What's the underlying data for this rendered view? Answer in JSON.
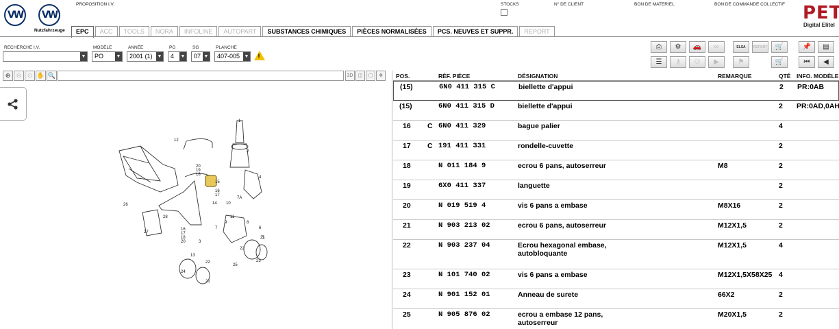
{
  "header": {
    "brand_sub": "Nutzfahrzeuge",
    "proposition_label": "PROPOSITION I.V.",
    "stocks_label": "STOCKS",
    "client_label": "N° DE CLIENT",
    "material_label": "BON DE MATERIEL",
    "order_label": "BON DE COMMANDE COLLECTIF",
    "logo_text": "PETK",
    "logo_sub": "Digital Elitel"
  },
  "tabs": [
    {
      "label": "EPC",
      "state": "active"
    },
    {
      "label": "ACC",
      "state": "disabled"
    },
    {
      "label": "TOOLS",
      "state": "disabled"
    },
    {
      "label": "NORA",
      "state": "disabled"
    },
    {
      "label": "INFOLINE",
      "state": "disabled"
    },
    {
      "label": "AUTOPART",
      "state": "disabled"
    },
    {
      "label": "SUBSTANCES CHIMIQUES",
      "state": "enabled"
    },
    {
      "label": "PIÈCES NORMALISÉES",
      "state": "enabled"
    },
    {
      "label": "PCS. NEUVES ET SUPPR.",
      "state": "enabled"
    },
    {
      "label": "REPORT",
      "state": "disabled"
    }
  ],
  "filters": {
    "recherche_label": "RECHERCHE I.V.",
    "recherche_value": "",
    "modele_label": "MODÈLE",
    "modele_value": "PO",
    "annee_label": "ANNÉE",
    "annee_value": "2001 (1)",
    "pg_label": "PG",
    "pg_value": "4",
    "sg_label": "SG",
    "sg_value": "07",
    "planche_label": "PLANCHE",
    "planche_value": "407-005"
  },
  "toolbar": {
    "elsa_label": "ELSA",
    "report_label": "REPORT"
  },
  "illustration": {
    "view3d_label": "3D",
    "callouts": [
      "12",
      "20",
      "19",
      "18",
      "15",
      "16",
      "17",
      "14",
      "26",
      "28",
      "27",
      "16",
      "17",
      "18",
      "20",
      "3",
      "10",
      "11",
      "9",
      "7",
      "8",
      "6",
      "5",
      "7A",
      "1",
      "2",
      "4",
      "13",
      "22",
      "24",
      "21",
      "25",
      "23",
      "21",
      "22"
    ]
  },
  "table": {
    "headers": {
      "pos": "POS.",
      "ref": "RÉF. PIÈCE",
      "desig": "DÉSIGNATION",
      "remarque": "REMARQUE",
      "qte": "QTÉ",
      "info": "INFO. MODÈLE"
    },
    "rows": [
      {
        "pos": "(15)",
        "flag": "",
        "ref": "6N0  411  315  C",
        "desig": "biellette d'appui",
        "desig2": "",
        "remarque": "",
        "qte": "2",
        "info": "PR:0AB"
      },
      {
        "pos": "(15)",
        "flag": "",
        "ref": "6N0  411  315  D",
        "desig": "biellette d'appui",
        "desig2": "",
        "remarque": "",
        "qte": "2",
        "info": "PR:0AD,0AH"
      },
      {
        "pos": "16",
        "flag": "C",
        "ref": "6N0  411  329",
        "desig": "bague palier",
        "desig2": "",
        "remarque": "",
        "qte": "4",
        "info": ""
      },
      {
        "pos": "17",
        "flag": "C",
        "ref": "191  411  331",
        "desig": "rondelle-cuvette",
        "desig2": "",
        "remarque": "",
        "qte": "2",
        "info": ""
      },
      {
        "pos": "18",
        "flag": "",
        "ref": "N    011  184  9",
        "desig": "ecrou 6 pans, autoserreur",
        "desig2": "",
        "remarque": "M8",
        "qte": "2",
        "info": ""
      },
      {
        "pos": "19",
        "flag": "",
        "ref": "6X0  411  337",
        "desig": "languette",
        "desig2": "",
        "remarque": "",
        "qte": "2",
        "info": ""
      },
      {
        "pos": "20",
        "flag": "",
        "ref": "N    019  519  4",
        "desig": "vis 6 pans a embase",
        "desig2": "",
        "remarque": "M8X16",
        "qte": "2",
        "info": ""
      },
      {
        "pos": "21",
        "flag": "",
        "ref": "N    903  213  02",
        "desig": "ecrou 6 pans, autoserreur",
        "desig2": "",
        "remarque": "M12X1,5",
        "qte": "2",
        "info": ""
      },
      {
        "pos": "22",
        "flag": "",
        "ref": "N    903  237  04",
        "desig": "Ecrou hexagonal embase,",
        "desig2": "autobloquante",
        "remarque": "M12X1,5",
        "qte": "4",
        "info": ""
      },
      {
        "pos": "23",
        "flag": "",
        "ref": "N    101  740  02",
        "desig": "vis 6 pans a embase",
        "desig2": "",
        "remarque": "M12X1,5X58X25",
        "qte": "4",
        "info": ""
      },
      {
        "pos": "24",
        "flag": "",
        "ref": "N    901  152  01",
        "desig": "Anneau de surete",
        "desig2": "",
        "remarque": "66X2",
        "qte": "2",
        "info": ""
      },
      {
        "pos": "25",
        "flag": "",
        "ref": "N    905  876  02",
        "desig": "ecrou a embase 12 pans,",
        "desig2": "autoserreur",
        "remarque": "M20X1,5",
        "qte": "2",
        "info": ""
      }
    ]
  }
}
